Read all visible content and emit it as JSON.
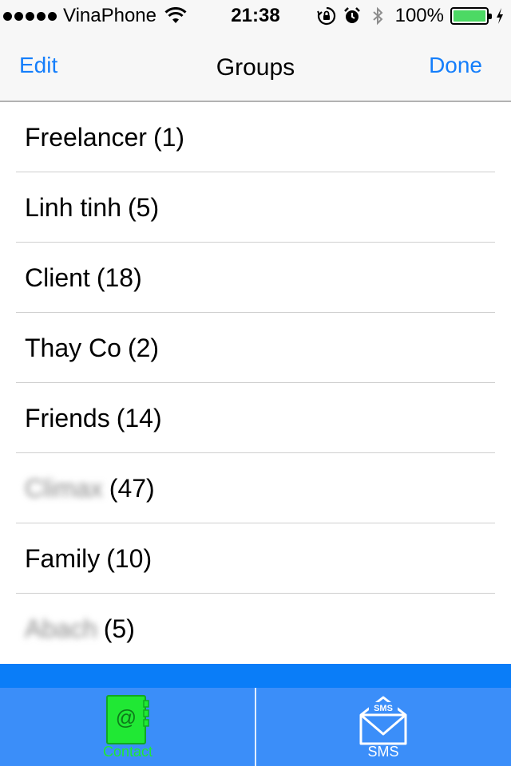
{
  "status_bar": {
    "carrier": "VinaPhone",
    "time": "21:38",
    "battery_percent": "100%",
    "battery_level": 1.0,
    "icons": [
      "signal-dots-icon",
      "wifi-icon",
      "orientation-lock-icon",
      "alarm-icon",
      "bluetooth-icon",
      "battery-icon",
      "charging-icon"
    ]
  },
  "nav": {
    "left_label": "Edit",
    "title": "Groups",
    "right_label": "Done"
  },
  "groups": [
    {
      "name": "Freelancer",
      "count": "(1)",
      "blurred": false
    },
    {
      "name": "Linh tinh",
      "count": "(5)",
      "blurred": false
    },
    {
      "name": "Client",
      "count": "(18)",
      "blurred": false
    },
    {
      "name": "Thay Co",
      "count": "(2)",
      "blurred": false
    },
    {
      "name": "Friends",
      "count": "(14)",
      "blurred": false
    },
    {
      "name": "Climax",
      "count": "(47)",
      "blurred": true
    },
    {
      "name": "Family",
      "count": "(10)",
      "blurred": false
    },
    {
      "name": "Abach",
      "count": "(5)",
      "blurred": true
    }
  ],
  "tabs": [
    {
      "label": "Contact",
      "icon": "contact-book-icon",
      "selected": true,
      "color": "#20e834"
    },
    {
      "label": "SMS",
      "icon": "envelope-icon",
      "icon_text": "SMS",
      "selected": false,
      "color": "#ffffff"
    }
  ],
  "colors": {
    "accent": "#147efb",
    "tab_bar": "#3b8ef9",
    "strip": "#0a7df8",
    "active_tab": "#20e834"
  }
}
